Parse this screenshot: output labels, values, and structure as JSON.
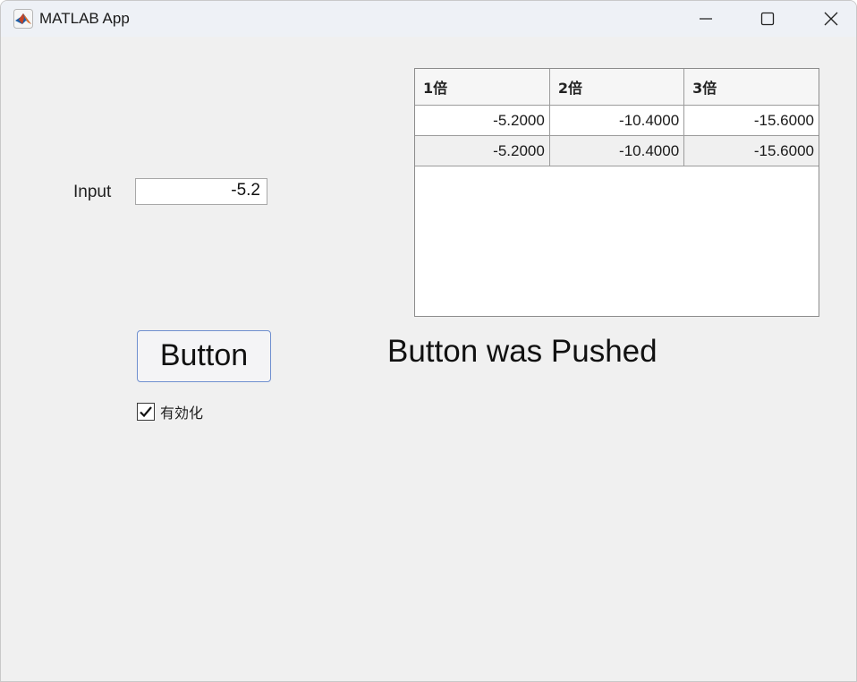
{
  "window": {
    "title": "MATLAB App",
    "app_icon": "matlab-membrane-icon",
    "controls": {
      "minimize_icon": "minimize-icon",
      "maximize_icon": "maximize-icon",
      "close_icon": "close-icon"
    }
  },
  "form": {
    "input_label": "Input",
    "input_value": "-5.2",
    "button_label": "Button",
    "checkbox_label": "有効化",
    "checkbox_checked": true,
    "status_text": "Button was Pushed"
  },
  "table": {
    "columns": [
      "1倍",
      "2倍",
      "3倍"
    ],
    "rows": [
      [
        "-5.2000",
        "-10.4000",
        "-15.6000"
      ],
      [
        "-5.2000",
        "-10.4000",
        "-15.6000"
      ]
    ]
  },
  "colors": {
    "background": "#f0f0f0",
    "titlebar": "#eef1f6",
    "button_border": "#6f8fcf",
    "table_stripe": "#f0f0f0"
  }
}
